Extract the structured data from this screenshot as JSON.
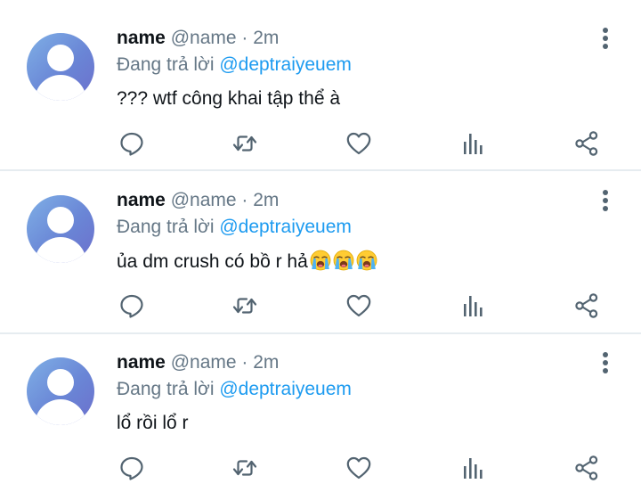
{
  "tweets": [
    {
      "name": "name",
      "handle": "@name",
      "separator": "·",
      "time": "2m",
      "reply_prefix": "Đang trả lời",
      "reply_to": "@deptraiyeuem",
      "text": "??? wtf công khai tập thể à",
      "emoji_count": 0
    },
    {
      "name": "name",
      "handle": "@name",
      "separator": "·",
      "time": "2m",
      "reply_prefix": "Đang trả lời",
      "reply_to": "@deptraiyeuem",
      "text": "ủa dm crush có bồ r hả",
      "emoji_count": 3,
      "emoji_icon": "loudly-crying-face-emoji"
    },
    {
      "name": "name",
      "handle": "@name",
      "separator": "·",
      "time": "2m",
      "reply_prefix": "Đang trả lời",
      "reply_to": "@deptraiyeuem",
      "text": "lổ rồi lổ r",
      "emoji_count": 0
    }
  ],
  "icons": {
    "more": "more-vertical-icon",
    "reply": "reply-icon",
    "retweet": "retweet-icon",
    "like": "like-heart-icon",
    "stats": "stats-icon",
    "share": "share-icon"
  },
  "colors": {
    "text": "#0f1419",
    "secondary": "#657786",
    "link": "#1d9bf0",
    "divider": "#e6ecf0",
    "action_icon": "#536471",
    "avatar_from": "#7fb0e6",
    "avatar_to": "#6c6fcc"
  }
}
